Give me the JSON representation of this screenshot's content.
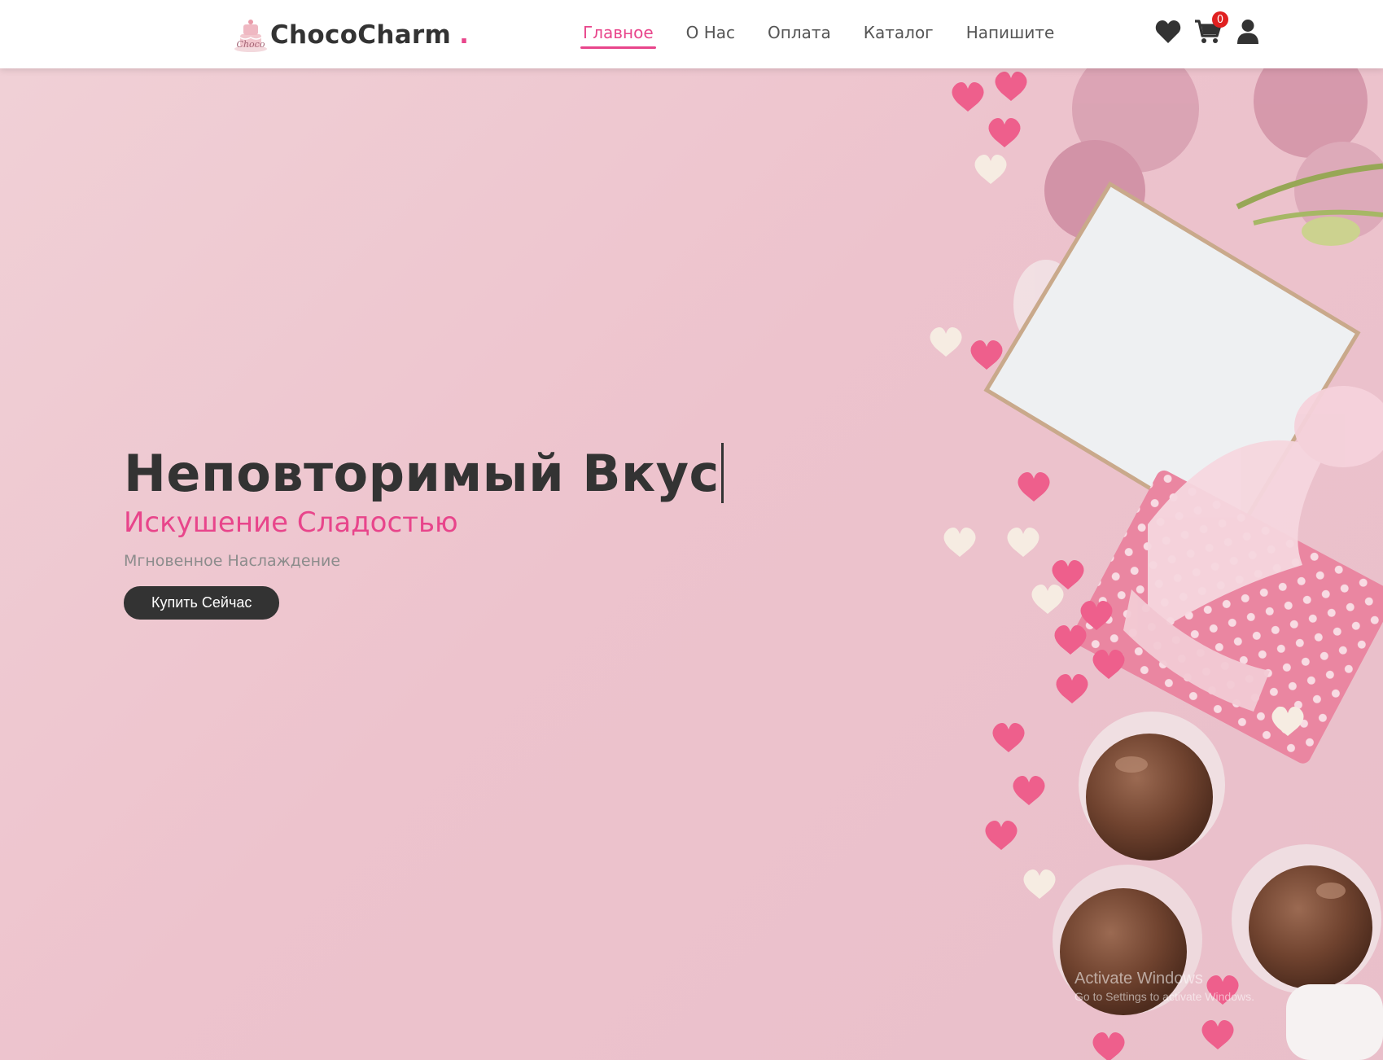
{
  "header": {
    "brand": "ChocoCharm",
    "brand_dot": ".",
    "logo_script": "Choco",
    "nav": [
      {
        "label": "Главное",
        "active": true
      },
      {
        "label": "О Нас",
        "active": false
      },
      {
        "label": "Оплата",
        "active": false
      },
      {
        "label": "Каталог",
        "active": false
      },
      {
        "label": "Напишите",
        "active": false
      }
    ],
    "icons": [
      "heart-icon",
      "cart-icon",
      "user-icon"
    ],
    "cart_count": "0"
  },
  "hero": {
    "title": "Неповторимый Вкус",
    "subtitle": "Искушение Сладостью",
    "description": "Мгновенное Наслаждение",
    "button_label": "Купить Сейчас"
  },
  "watermark": {
    "title": "Activate Windows",
    "subtitle": "Go to Settings to activate Windows."
  },
  "colors": {
    "accent": "#e8458b",
    "text_dark": "#333333",
    "hero_bg": "#f0cdd4",
    "badge": "#e02020"
  }
}
